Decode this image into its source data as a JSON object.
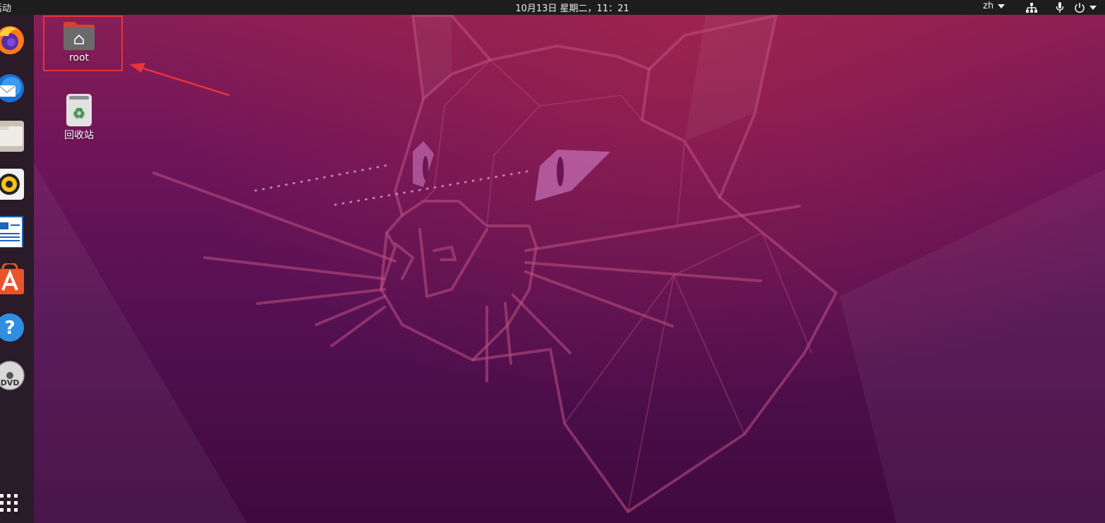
{
  "topbar": {
    "activities_label": "活动",
    "clock": "10月13日 星期二，11：21",
    "input_method": "zh"
  },
  "dock": {
    "items": [
      {
        "name": "firefox",
        "icon": "firefox-icon"
      },
      {
        "name": "thunderbird",
        "icon": "thunderbird-mail-icon"
      },
      {
        "name": "files",
        "icon": "files-folder-icon"
      },
      {
        "name": "rhythmbox",
        "icon": "rhythmbox-speaker-icon"
      },
      {
        "name": "libreoffice-writer",
        "icon": "writer-document-icon"
      },
      {
        "name": "ubuntu-software",
        "icon": "software-store-icon"
      },
      {
        "name": "help",
        "icon": "help-icon"
      },
      {
        "name": "dvd",
        "icon": "dvd-disc-icon"
      },
      {
        "name": "show-applications",
        "icon": "app-grid-icon"
      }
    ],
    "dvd_text": "DVD"
  },
  "desktop": {
    "icons": [
      {
        "label": "root",
        "icon": "home-folder-icon"
      },
      {
        "label": "回收站",
        "icon": "trash-icon"
      }
    ]
  },
  "annotation": {
    "highlight_color": "#e8333a"
  },
  "colors": {
    "topbar": "#1d1d1d",
    "dock": "#2a1b28",
    "wallpaper_top": "#8b1f55",
    "wallpaper_bottom": "#3f0a3f"
  }
}
